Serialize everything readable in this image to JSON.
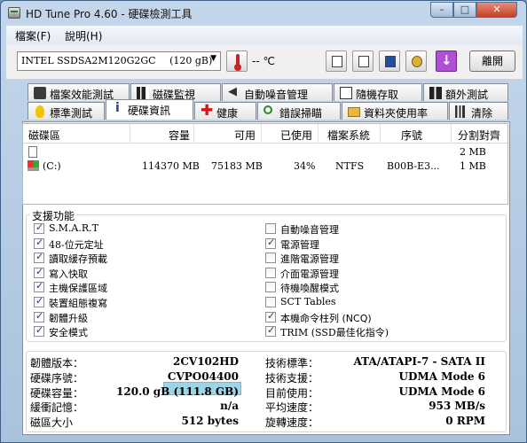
{
  "title_bar": {
    "title": "HD Tune Pro 4.60 - 硬碟檢測工具",
    "minimize": "–",
    "maximize": "□",
    "close": "✕"
  },
  "menu": {
    "items": [
      "檔案(F)",
      "說明(H)"
    ]
  },
  "toolbar": {
    "drive": "INTEL SSDSA2M120G2GC",
    "drive_size": "(120 gB)",
    "temperature": "-- ℃",
    "exit_label": "離開"
  },
  "tabs": {
    "top_row": [
      "檔案效能測試",
      "磁碟監視",
      "自動噪音管理",
      "隨機存取",
      "額外測試"
    ],
    "bottom_row": [
      "標準測試",
      "硬碟資訊",
      "健康",
      "錯誤掃瞄",
      "資料夾使用率",
      "清除"
    ],
    "active": "硬碟資訊"
  },
  "partition_list": {
    "headers": [
      "磁碟區",
      "容量",
      "可用",
      "已使用",
      "檔案系統",
      "序號",
      "分割對齊"
    ],
    "rows": [
      {
        "volume": "",
        "capacity": "",
        "free": "",
        "used": "",
        "fs": "",
        "serial": "",
        "alignment": "2 MB"
      },
      {
        "volume": "(C:)",
        "capacity": "114370 MB",
        "free": "75183 MB",
        "used": "34%",
        "fs": "NTFS",
        "serial": "B00B-E3...",
        "alignment": "1 MB"
      }
    ]
  },
  "features": {
    "title": "支援功能",
    "left": [
      {
        "label": "S.M.A.R.T",
        "checked": true
      },
      {
        "label": "48-位元定址",
        "checked": true
      },
      {
        "label": "讀取緩存預載",
        "checked": true
      },
      {
        "label": "寫入快取",
        "checked": true
      },
      {
        "label": "主機保護區域",
        "checked": true
      },
      {
        "label": "裝置組態複寫",
        "checked": true
      },
      {
        "label": "韌體升級",
        "checked": true
      },
      {
        "label": "安全模式",
        "checked": true
      }
    ],
    "right": [
      {
        "label": "自動噪音管理",
        "checked": false
      },
      {
        "label": "電源管理",
        "checked": true
      },
      {
        "label": "進階電源管理",
        "checked": false
      },
      {
        "label": "介面電源管理",
        "checked": false
      },
      {
        "label": "待機喚醒模式",
        "checked": false
      },
      {
        "label": "SCT Tables",
        "checked": false
      },
      {
        "label": "本機命令柱列 (NCQ)",
        "checked": true
      },
      {
        "label": "TRIM (SSD最佳化指令)",
        "checked": true
      }
    ]
  },
  "info": {
    "left": [
      {
        "label": "韌體版本：",
        "value": "2CV102HD"
      },
      {
        "label": "硬碟序號：",
        "value": "CVPO04400"
      },
      {
        "label": "硬碟容量：",
        "value": "120.0 gB (111.8 GB)"
      },
      {
        "label": "緩衝記憶：",
        "value": "n/a"
      },
      {
        "label": "磁區大小",
        "value": "512 bytes"
      }
    ],
    "right": [
      {
        "label": "技術標準：",
        "value": "ATA/ATAPI-7 - SATA II"
      },
      {
        "label": "技術支援：",
        "value": "UDMA Mode 6"
      },
      {
        "label": "目前使用：",
        "value": "UDMA Mode 6"
      },
      {
        "label": "平均速度：",
        "value": "953 MB/s"
      },
      {
        "label": "旋轉速度：",
        "value": "0 RPM"
      }
    ]
  },
  "colors": {
    "frame": "#a9c2de",
    "close_button": "#c53f22",
    "serial_mask": "#9fd3e6"
  }
}
